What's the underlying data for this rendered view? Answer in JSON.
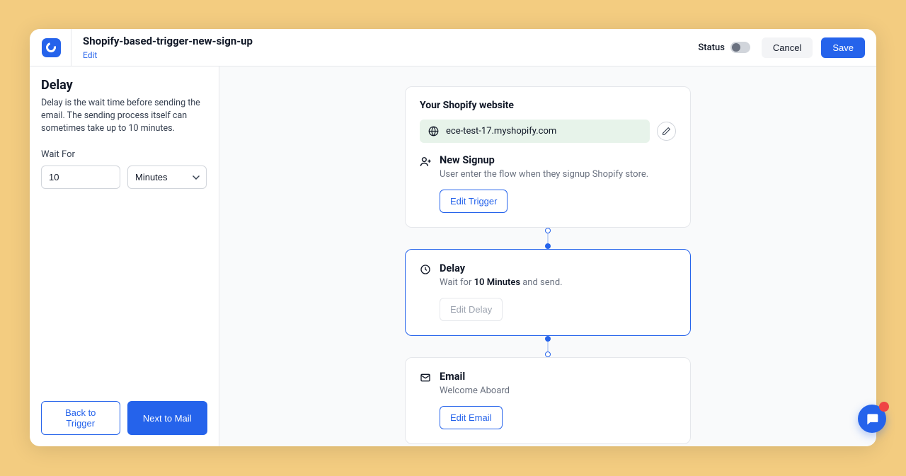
{
  "header": {
    "title": "Shopify-based-trigger-new-sign-up",
    "edit_label": "Edit",
    "status_label": "Status",
    "cancel_label": "Cancel",
    "save_label": "Save"
  },
  "sidebar": {
    "heading": "Delay",
    "description": "Delay is the wait time before sending the email. The sending process itself can sometimes take up to 10 minutes.",
    "wait_for_label": "Wait For",
    "wait_value": "10",
    "wait_unit": "Minutes",
    "back_label": "Back to Trigger",
    "next_label": "Next to Mail"
  },
  "flow": {
    "trigger": {
      "section_title": "Your Shopify website",
      "site_url": "ece-test-17.myshopify.com",
      "title": "New Signup",
      "subtitle": "User enter the flow when they signup Shopify store.",
      "edit_label": "Edit Trigger"
    },
    "delay": {
      "title": "Delay",
      "sub_prefix": "Wait for ",
      "sub_bold": "10 Minutes",
      "sub_suffix": " and send.",
      "edit_label": "Edit Delay"
    },
    "email": {
      "title": "Email",
      "subtitle": "Welcome Aboard",
      "edit_label": "Edit Email"
    }
  }
}
